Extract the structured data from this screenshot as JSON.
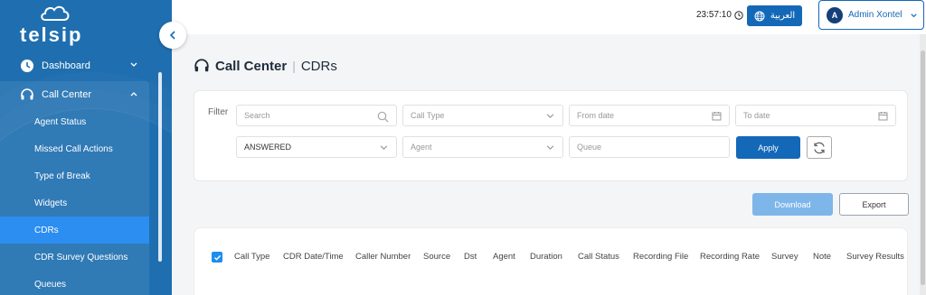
{
  "app": {
    "logo_text": "telsip"
  },
  "sidebar": {
    "items": [
      {
        "label": "Dashboard",
        "icon": "clock-icon"
      },
      {
        "label": "Call Center",
        "icon": "headset-icon"
      }
    ],
    "sub_items": [
      {
        "label": "Agent Status"
      },
      {
        "label": "Missed Call Actions"
      },
      {
        "label": "Type of Break"
      },
      {
        "label": "Widgets"
      },
      {
        "label": "CDRs",
        "active": true
      },
      {
        "label": "CDR Survey Questions"
      },
      {
        "label": "Queues"
      }
    ]
  },
  "header": {
    "time": "23:57:10",
    "language_label": "العربية",
    "user": {
      "initial": "A",
      "name": "Admin Xontel"
    }
  },
  "page": {
    "title": "Call Center",
    "subtitle": "CDRs"
  },
  "filter": {
    "label": "Filter",
    "search_placeholder": "Search",
    "call_type_placeholder": "Call Type",
    "from_date_placeholder": "From date",
    "to_date_placeholder": "To date",
    "status_value": "ANSWERED",
    "agent_placeholder": "Agent",
    "queue_placeholder": "Queue",
    "apply_label": "Apply"
  },
  "actions": {
    "download_label": "Download",
    "export_label": "Export"
  },
  "table": {
    "columns": [
      "Call Type",
      "CDR Date/Time",
      "Caller Number",
      "Source",
      "Dst",
      "Agent",
      "Duration",
      "Call Status",
      "Recording File",
      "Recording Rate",
      "Survey",
      "Note",
      "Survey Results"
    ]
  },
  "colors": {
    "sidebar_bg": "#1f6fb0",
    "active_item": "#2b8ef0",
    "primary": "#1468b8",
    "download_disabled": "#7fb6ea"
  }
}
